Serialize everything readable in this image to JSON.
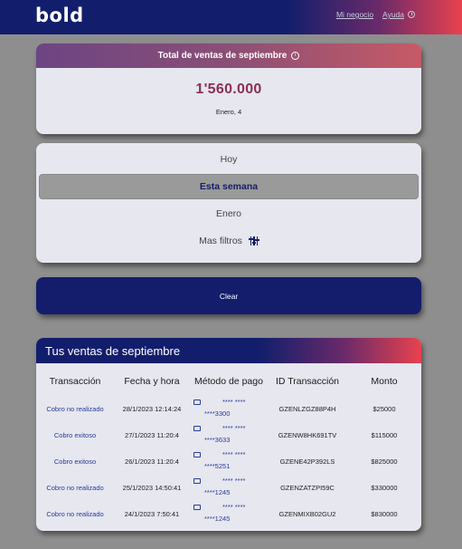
{
  "header": {
    "logo": "bold",
    "nav_business": "Mi negocio",
    "nav_help": "Ayuda"
  },
  "total": {
    "title": "Total de ventas de septiembre",
    "amount": "1'560.000",
    "date": "Enero, 4"
  },
  "filters": {
    "today": "Hoy",
    "this_week": "Esta semana",
    "january": "Enero",
    "more_filters": "Mas filtros"
  },
  "clear_label": "Clear",
  "sales": {
    "title": "Tus ventas de septiembre",
    "columns": [
      "Transacción",
      "Fecha y hora",
      "Método de pago",
      "ID Transacción",
      "Monto"
    ],
    "rows": [
      {
        "status": "Cobro no realizado",
        "datetime": "28/1/2023 12:14:24",
        "method_a": "**** ****",
        "method_b": "****3300",
        "id": "GZENLZGZ88P4H",
        "amount": "$25000"
      },
      {
        "status": "Cobro exitoso",
        "datetime": "27/1/2023 11:20:4",
        "method_a": "**** ****",
        "method_b": "****3633",
        "id": "GZENW8HK691TV",
        "amount": "$115000"
      },
      {
        "status": "Cobro exitoso",
        "datetime": "26/1/2023 11:20:4",
        "method_a": "**** ****",
        "method_b": "****5251",
        "id": "GZENE42P392LS",
        "amount": "$825000"
      },
      {
        "status": "Cobro no realizado",
        "datetime": "25/1/2023 14:50:41",
        "method_a": "**** ****",
        "method_b": "****1245",
        "id": "GZENZATZPI59C",
        "amount": "$330000"
      },
      {
        "status": "Cobro no realizado",
        "datetime": "24/1/2023 7:50:41",
        "method_a": "**** ****",
        "method_b": "****1245",
        "id": "GZENMIXB02GU2",
        "amount": "$830000"
      }
    ]
  }
}
